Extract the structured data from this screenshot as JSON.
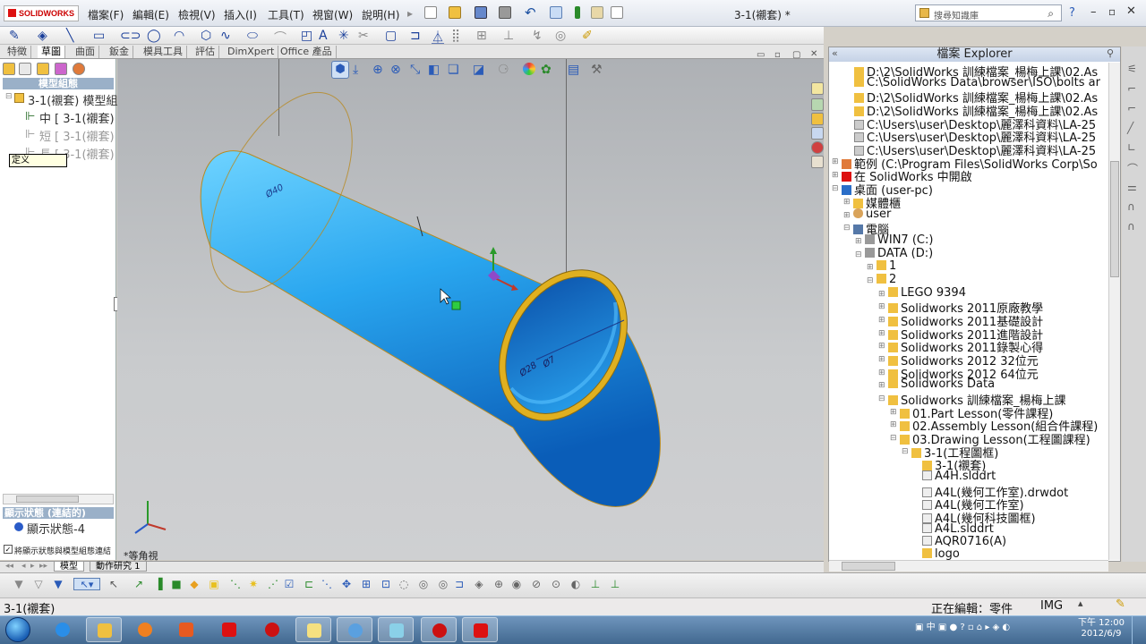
{
  "titlebar": {
    "logo": "SOLIDWORKS",
    "menus": [
      "檔案(F)",
      "編輯(E)",
      "檢視(V)",
      "插入(I)",
      "工具(T)",
      "視窗(W)",
      "說明(H)"
    ],
    "doc_title": "3-1(襯套) *",
    "search_placeholder": "搜尋知識庫"
  },
  "command_tabs": [
    "特徵",
    "草圖",
    "曲面",
    "鈑金",
    "模具工具",
    "評估",
    "DimXpert",
    "Office 產品"
  ],
  "active_command_tab": "草圖",
  "feature_manager": {
    "header": "模型組態",
    "root": "3-1(襯套) 模型組",
    "items": [
      {
        "prefix": "中",
        "label": "3-1(襯套)"
      },
      {
        "prefix": "短",
        "label": "3-1(襯套)"
      },
      {
        "prefix": "長",
        "label": "3-1(襯套)"
      }
    ],
    "tooltip": "定义",
    "display_header": "顯示狀態 (連結的)",
    "display_state": "顯示狀態-4",
    "link_option": "將顯示狀態與模型組態連結"
  },
  "viewport": {
    "view_label": "*等角視",
    "dim_top": "Ø40",
    "dim_bottom": "Ø28",
    "dim_diam": "Ø7"
  },
  "model_tabs": [
    "模型",
    "動作研究 1"
  ],
  "explorer": {
    "title": "檔案 Explorer",
    "recent": [
      "D:\\2\\SolidWorks 訓練檔案_楊梅上課\\02.As",
      "C:\\SolidWorks Data\\browser\\ISO\\bolts ar",
      "D:\\2\\SolidWorks 訓練檔案_楊梅上課\\02.As",
      "D:\\2\\SolidWorks 訓練檔案_楊梅上課\\02.As",
      "C:\\Users\\user\\Desktop\\麗澤科資料\\LA-25",
      "C:\\Users\\user\\Desktop\\麗澤科資料\\LA-25",
      "C:\\Users\\user\\Desktop\\麗澤科資料\\LA-25"
    ],
    "samples": "範例 (C:\\Program Files\\SolidWorks Corp\\So",
    "open_in": "在 SolidWorks 中開啟",
    "desktop": "桌面 (user-pc)",
    "libraries": "媒體櫃",
    "user": "user",
    "computer": "電腦",
    "drive_c": "WIN7 (C:)",
    "drive_d": "DATA (D:)",
    "folder_1": "1",
    "folder_2": "2",
    "sub2": [
      "LEGO 9394",
      "Solidworks 2011原廠教學",
      "Solidworks 2011基礎設計",
      "Solidworks 2011進階設計",
      "Solidworks 2011錄製心得",
      "Solidworks 2012 32位元",
      "Solidworks 2012 64位元",
      "Solidworks Data",
      "Solidworks 訓練檔案_楊梅上課"
    ],
    "lessons": [
      "01.Part Lesson(零件課程)",
      "02.Assembly Lesson(組合件課程)",
      "03.Drawing Lesson(工程圖課程)"
    ],
    "drawing_folder": "3-1(工程圖框)",
    "files": [
      "3-1(襯套)",
      "A4H.slddrt",
      "A4L(幾何工作室).drwdot",
      "A4L(幾何工作室)",
      "A4L(幾何科技圖框)",
      "A4L.slddrt",
      "AQR0716(A)",
      "logo"
    ]
  },
  "status": {
    "left": "3-1(襯套)",
    "editing": "正在編輯：零件",
    "units": "IMG"
  },
  "clock": {
    "time": "下午 12:00",
    "date": "2012/6/9"
  },
  "tray": {
    "lang": "中"
  },
  "colors": {
    "cylinder": "#29a6ef",
    "rim": "#e0b020",
    "accent": "#1a3f9a"
  }
}
